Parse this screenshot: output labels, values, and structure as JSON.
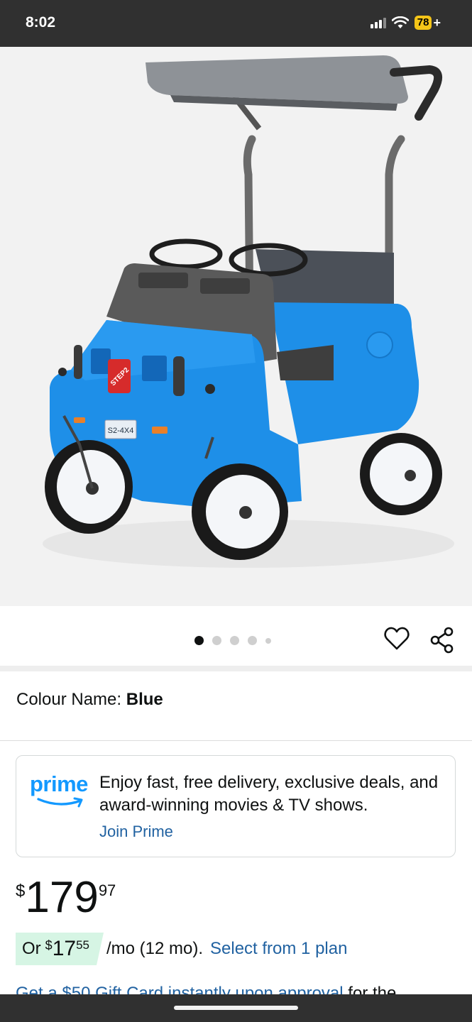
{
  "status_bar": {
    "time": "8:02",
    "battery": "78",
    "battery_suffix": "+"
  },
  "product_image": {
    "icon": "ride-on-car-image",
    "plate_text": "S2-4X4",
    "badge_text": "STEP2",
    "colors": {
      "body": "#1e8fe8",
      "canopy": "#8e9297",
      "seat": "#5a5a5a",
      "wheels": "#ffffff",
      "tires": "#1a1a1a"
    }
  },
  "carousel": {
    "total_dots": 5,
    "active_index": 0
  },
  "colour": {
    "label": "Colour Name: ",
    "value": "Blue"
  },
  "prime": {
    "logo_text": "prime",
    "description": "Enjoy fast, free delivery, exclusive deals, and award-winning movies & TV shows.",
    "link": "Join Prime",
    "brand_color": "#1399ff"
  },
  "price": {
    "symbol": "$",
    "whole": "179",
    "fraction": "97"
  },
  "monthly": {
    "prefix": "Or",
    "symbol": "$",
    "whole": "17",
    "fraction": "55",
    "suffix": "/mo (12 mo).",
    "link": "Select from 1 plan"
  },
  "gift_card": {
    "link": "Get a $50 Gift Card instantly upon approval",
    "tail": " for the"
  },
  "colors": {
    "link": "#2162a1",
    "monthly_badge": "#d6f5e4",
    "status_bar": "#303030"
  }
}
